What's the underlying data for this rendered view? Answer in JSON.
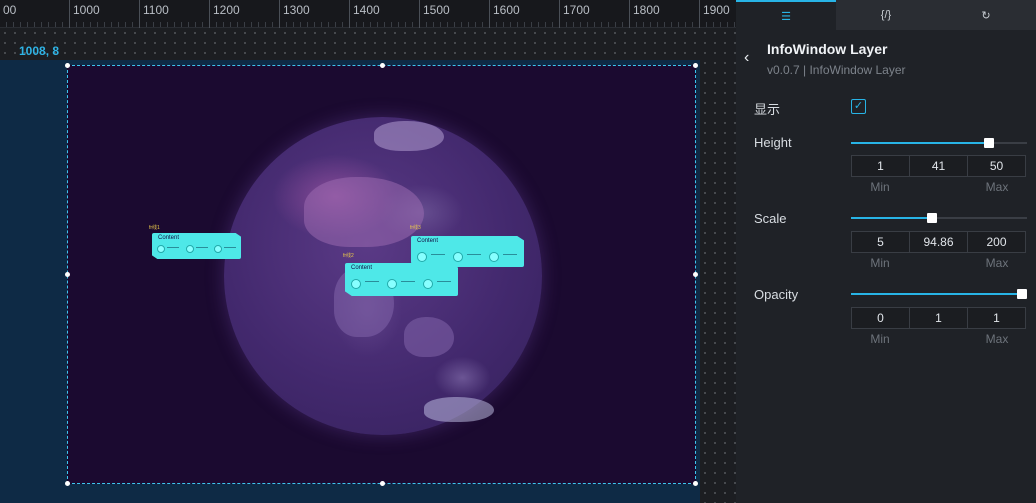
{
  "ruler": {
    "ticks": [
      "00",
      "1000",
      "1100",
      "1200",
      "1300",
      "1400",
      "1500",
      "1600",
      "1700",
      "1800",
      "1900"
    ]
  },
  "canvas": {
    "coordinate_label": "1008, 8",
    "info_windows": [
      {
        "title": "Content",
        "tag": "fr线1"
      },
      {
        "title": "Content",
        "tag": "fr线2"
      },
      {
        "title": "Content",
        "tag": "fr线3"
      }
    ]
  },
  "panel": {
    "tabs": [
      {
        "icon": "sliders-icon",
        "glyph": "☰"
      },
      {
        "icon": "code-icon",
        "glyph": "{/}"
      },
      {
        "icon": "interaction-icon",
        "glyph": "↻"
      }
    ],
    "title": "InfoWindow Layer",
    "subtitle": "v0.0.7 | InfoWindow Layer",
    "show_label": "显示",
    "show_checked": true,
    "check_glyph": "✓",
    "back_glyph": "‹",
    "min_label": "Min",
    "max_label": "Max",
    "properties": [
      {
        "label": "Height",
        "min": "1",
        "value": "41",
        "max": "50",
        "fraction": 0.8
      },
      {
        "label": "Scale",
        "min": "5",
        "value": "94.86",
        "max": "200",
        "fraction": 0.46
      },
      {
        "label": "Opacity",
        "min": "0",
        "value": "1",
        "max": "1",
        "fraction": 1.0
      }
    ]
  },
  "colors": {
    "accent": "#28b4e6",
    "stage_bg": "#1b0a30",
    "info_window": "#4ee8e8"
  }
}
